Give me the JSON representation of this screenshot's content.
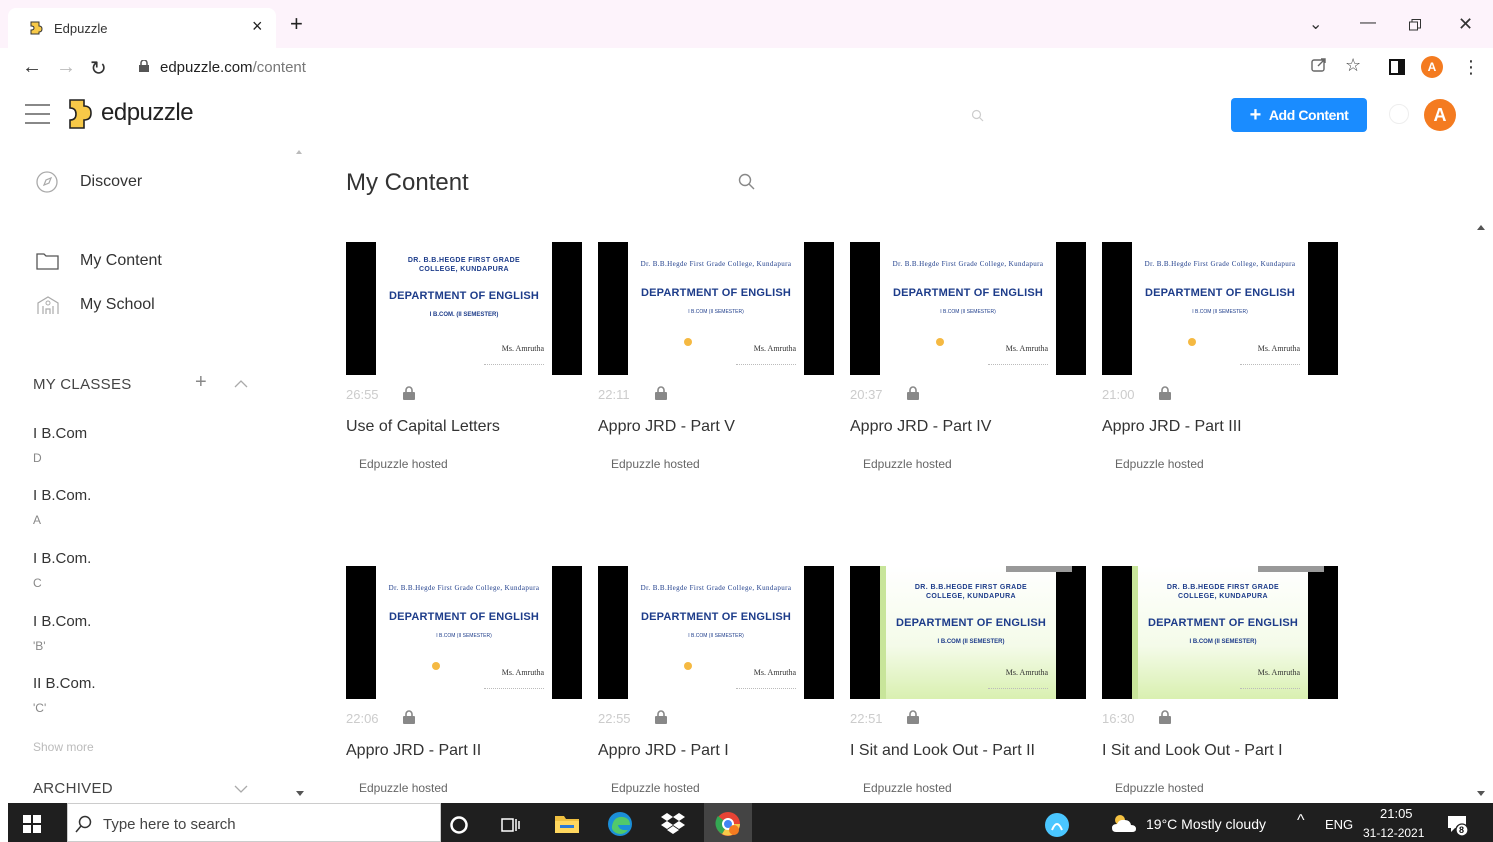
{
  "browser": {
    "tab_title": "Edpuzzle",
    "url_domain": "edpuzzle.com",
    "url_path": "/content",
    "profile_initial": "A"
  },
  "app": {
    "logo_text": "edpuzzle",
    "add_content_label": "Add Content",
    "avatar_initial": "A"
  },
  "sidebar": {
    "discover": "Discover",
    "my_content": "My Content",
    "my_school": "My School",
    "my_classes_header": "MY CLASSES",
    "classes": [
      {
        "name": "I B.Com",
        "section": "D"
      },
      {
        "name": "I B.Com.",
        "section": "A"
      },
      {
        "name": "I B.Com.",
        "section": "C"
      },
      {
        "name": "I B.Com.",
        "section": "'B'"
      },
      {
        "name": "II B.Com.",
        "section": "'C'"
      }
    ],
    "show_more": "Show more",
    "archived_header": "ARCHIVED"
  },
  "main": {
    "title": "My Content",
    "thumb_text": {
      "college_caps": "DR. B.B.HEGDE FIRST GRADE COLLEGE, KUNDAPURA",
      "college_small": "Dr. B.B.Hegde First Grade College, Kundapura",
      "dept": "DEPARTMENT OF ENGLISH",
      "sem_a": "I B.COM. (II SEMESTER)",
      "sem_b": "I B.COM (II SEMESTER)",
      "author": "Ms. Amrutha"
    },
    "videos": [
      {
        "duration": "26:55",
        "title": "Use of Capital Letters",
        "host": "Edpuzzle hosted"
      },
      {
        "duration": "22:11",
        "title": "Appro JRD - Part V",
        "host": "Edpuzzle hosted"
      },
      {
        "duration": "20:37",
        "title": "Appro JRD - Part IV",
        "host": "Edpuzzle hosted"
      },
      {
        "duration": "21:00",
        "title": "Appro JRD - Part III",
        "host": "Edpuzzle hosted"
      },
      {
        "duration": "22:06",
        "title": "Appro JRD - Part II",
        "host": "Edpuzzle hosted"
      },
      {
        "duration": "22:55",
        "title": "Appro JRD - Part I",
        "host": "Edpuzzle hosted"
      },
      {
        "duration": "22:51",
        "title": "I Sit and Look Out - Part II",
        "host": "Edpuzzle hosted"
      },
      {
        "duration": "16:30",
        "title": "I Sit and Look Out - Part I",
        "host": "Edpuzzle hosted"
      }
    ]
  },
  "taskbar": {
    "search_placeholder": "Type here to search",
    "weather": "19°C  Mostly cloudy",
    "lang": "ENG",
    "time": "21:05",
    "date": "31-12-2021",
    "notif_count": "8"
  }
}
